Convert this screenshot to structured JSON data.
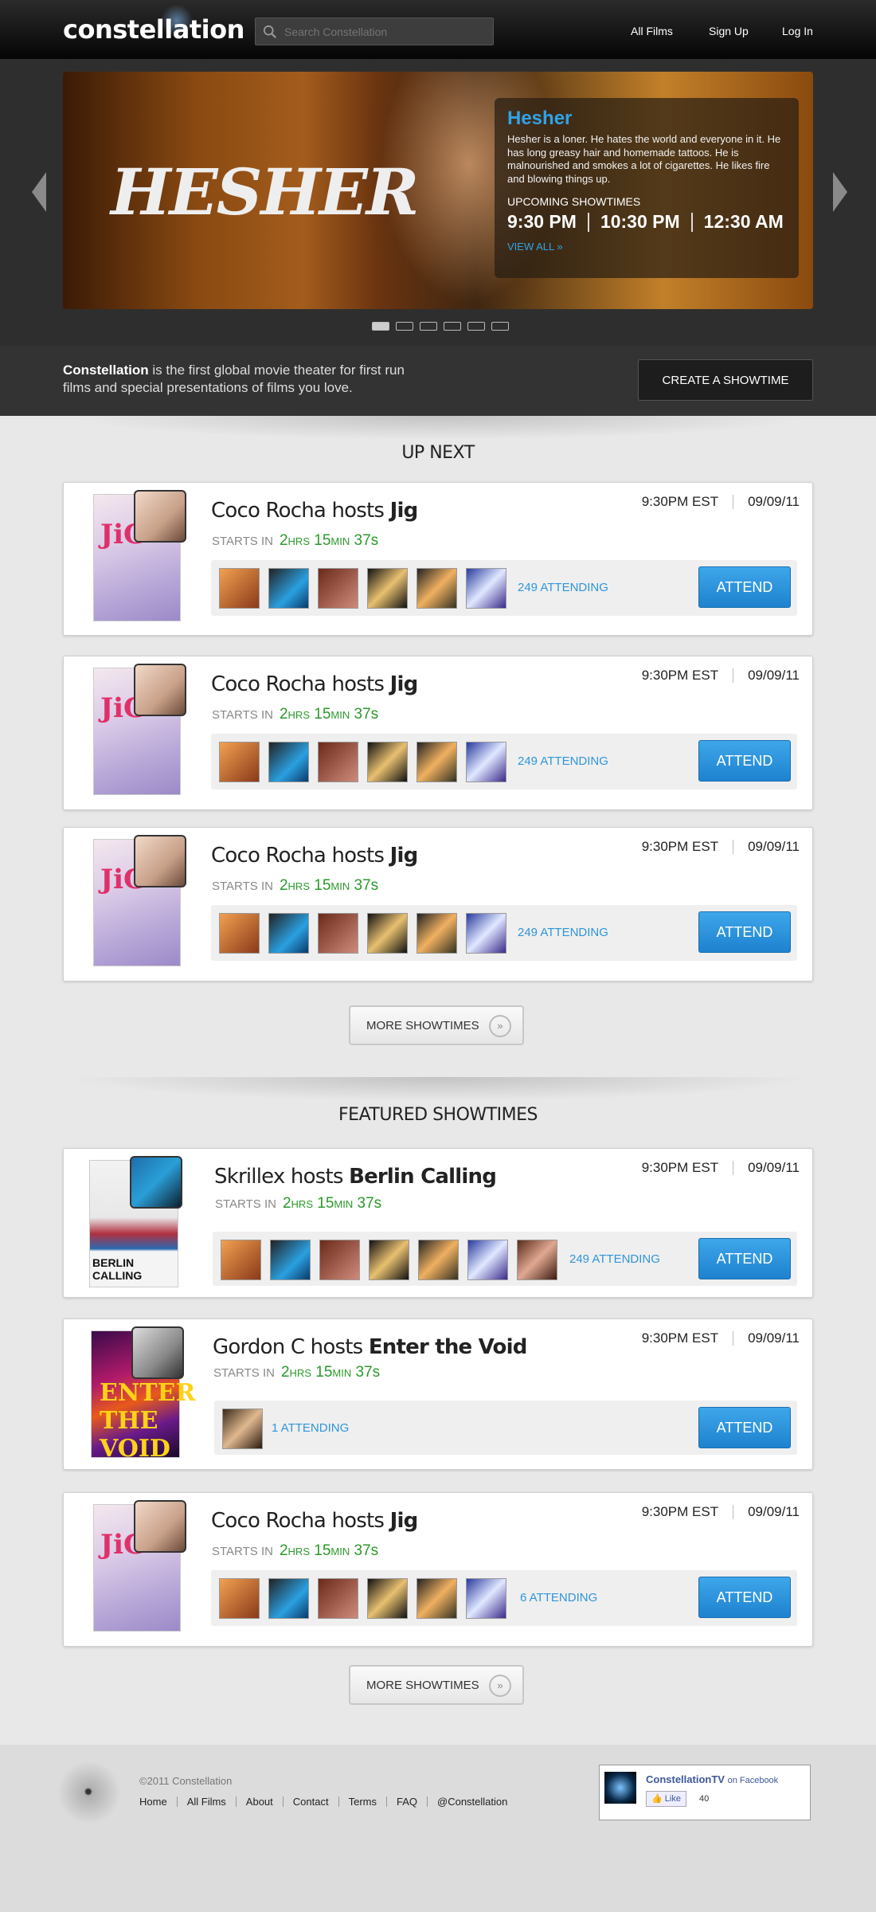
{
  "header": {
    "logo": "constellation",
    "search_placeholder": "Search Constellation",
    "nav": [
      "All Films",
      "Sign Up",
      "Log In"
    ]
  },
  "hero": {
    "title_art": "HESHER",
    "film": "Hesher",
    "description": "Hesher is a loner. He hates the world and everyone in it. He has long greasy hair and homemade tattoos. He is malnourished and smokes a lot of cigarettes. He likes fire and blowing things up.",
    "upcoming_label": "UPCOMING SHOWTIMES",
    "times": [
      "9:30 PM",
      "10:30 PM",
      "12:30 AM"
    ],
    "view_all": "VIEW ALL »",
    "slides": 6,
    "active_slide": 1
  },
  "intro": {
    "brand": "Constellation",
    "text": " is the first global movie theater for first run films and special presentations of films you love.",
    "create_button": "CREATE A SHOWTIME"
  },
  "up_next": {
    "title": "UP NEXT",
    "cards": [
      {
        "host": "Coco Rocha hosts ",
        "film": "Jig",
        "starts_label": "STARTS IN",
        "cd_h": "2",
        "cd_hrs": "HRS",
        "cd_m": "15",
        "cd_min": "MIN",
        "cd_s": "37s",
        "time": "9:30PM EST",
        "date": "09/09/11",
        "attending": "249 ATTENDING",
        "button": "ATTEND"
      },
      {
        "host": "Coco Rocha hosts ",
        "film": "Jig",
        "starts_label": "STARTS IN",
        "cd_h": "2",
        "cd_hrs": "HRS",
        "cd_m": "15",
        "cd_min": "MIN",
        "cd_s": "37s",
        "time": "9:30PM EST",
        "date": "09/09/11",
        "attending": "249 ATTENDING",
        "button": "ATTEND"
      },
      {
        "host": "Coco Rocha hosts ",
        "film": "Jig",
        "starts_label": "STARTS IN",
        "cd_h": "2",
        "cd_hrs": "HRS",
        "cd_m": "15",
        "cd_min": "MIN",
        "cd_s": "37s",
        "time": "9:30PM EST",
        "date": "09/09/11",
        "attending": "249 ATTENDING",
        "button": "ATTEND"
      }
    ],
    "more": "MORE SHOWTIMES"
  },
  "featured": {
    "title": "FEATURED SHOWTIMES",
    "cards": [
      {
        "host": "Skrillex hosts ",
        "film": "Berlin Calling",
        "poster_text": "BERLIN CALLING",
        "starts_label": "STARTS IN",
        "cd_h": "2",
        "cd_hrs": "HRS",
        "cd_m": "15",
        "cd_min": "MIN",
        "cd_s": "37s",
        "time": "9:30PM EST",
        "date": "09/09/11",
        "attending": "249 ATTENDING",
        "button": "ATTEND"
      },
      {
        "host": "Gordon C hosts ",
        "film": "Enter the Void",
        "poster_text": "ENTER THE VOID",
        "starts_label": "STARTS IN",
        "cd_h": "2",
        "cd_hrs": "HRS",
        "cd_m": "15",
        "cd_min": "MIN",
        "cd_s": "37s",
        "time": "9:30PM EST",
        "date": "09/09/11",
        "attending": "1 ATTENDING",
        "button": "ATTEND"
      },
      {
        "host": "Coco Rocha hosts ",
        "film": "Jig",
        "starts_label": "STARTS IN",
        "cd_h": "2",
        "cd_hrs": "HRS",
        "cd_m": "15",
        "cd_min": "MIN",
        "cd_s": "37s",
        "time": "9:30PM EST",
        "date": "09/09/11",
        "attending": "6 ATTENDING",
        "button": "ATTEND"
      }
    ],
    "more": "MORE SHOWTIMES"
  },
  "footer": {
    "copyright": "©2011 Constellation",
    "links": [
      "Home",
      "All Films",
      "About",
      "Contact",
      "Terms",
      "FAQ",
      "@Constellation"
    ],
    "facebook": {
      "page": "ConstellationTV",
      "on": "on Facebook",
      "like": "Like",
      "count": "40"
    }
  },
  "colors": {
    "accent": "#2f95dc",
    "countdown": "#2a9a2a",
    "topbar": "#111111"
  }
}
